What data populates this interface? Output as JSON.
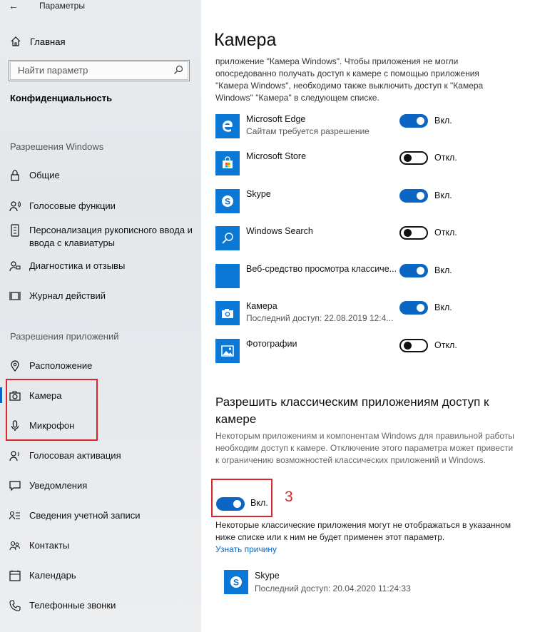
{
  "window": {
    "title": "Параметры"
  },
  "sidebar": {
    "home_label": "Главная",
    "search_placeholder": "Найти параметр",
    "section_title": "Конфиденциальность",
    "group_windows": "Разрешения Windows",
    "group_apps": "Разрешения приложений",
    "items": [
      {
        "label": "Общие",
        "icon": "lock-icon"
      },
      {
        "label": "Голосовые функции",
        "icon": "voice-icon"
      },
      {
        "label": "Персонализация рукописного ввода и ввода с клавиатуры",
        "icon": "handwriting-icon"
      },
      {
        "label": "Диагностика и отзывы",
        "icon": "feedback-icon"
      },
      {
        "label": "Журнал действий",
        "icon": "history-icon"
      },
      {
        "label": "Расположение",
        "icon": "location-icon"
      },
      {
        "label": "Камера",
        "icon": "camera-icon"
      },
      {
        "label": "Микрофон",
        "icon": "microphone-icon"
      },
      {
        "label": "Голосовая активация",
        "icon": "voice-activation-icon"
      },
      {
        "label": "Уведомления",
        "icon": "notifications-icon"
      },
      {
        "label": "Сведения учетной записи",
        "icon": "account-icon"
      },
      {
        "label": "Контакты",
        "icon": "contacts-icon"
      },
      {
        "label": "Календарь",
        "icon": "calendar-icon"
      },
      {
        "label": "Телефонные звонки",
        "icon": "phone-icon"
      }
    ]
  },
  "main": {
    "title": "Камера",
    "intro": "приложение \"Камера Windows\". Чтобы приложения не могли опосредованно получать доступ к камере с помощью приложения \"Камера Windows\", необходимо также выключить доступ к \"Камера Windows\" \"Камера\" в следующем списке.",
    "apps": [
      {
        "name": "Microsoft Edge",
        "sub": "Сайтам требуется разрешение",
        "state": "Вкл.",
        "on": true,
        "icon": "edge-icon"
      },
      {
        "name": "Microsoft Store",
        "sub": "",
        "state": "Откл.",
        "on": false,
        "icon": "store-icon"
      },
      {
        "name": "Skype",
        "sub": "",
        "state": "Вкл.",
        "on": true,
        "icon": "skype-icon"
      },
      {
        "name": "Windows Search",
        "sub": "",
        "state": "Откл.",
        "on": false,
        "icon": "search-app-icon"
      },
      {
        "name": "Веб-средство просмотра классиче...",
        "sub": "",
        "state": "Вкл.",
        "on": true,
        "icon": "web-viewer-icon"
      },
      {
        "name": "Камера",
        "sub": "Последний доступ: 22.08.2019 12:4...",
        "state": "Вкл.",
        "on": true,
        "icon": "camera-app-icon"
      },
      {
        "name": "Фотографии",
        "sub": "",
        "state": "Откл.",
        "on": false,
        "icon": "photos-icon"
      }
    ],
    "classic_heading": "Разрешить классическим приложениям доступ к камере",
    "classic_desc": "Некоторым приложениям и компонентам Windows для правильной работы необходим доступ к камере. Отключение этого параметра может привести к ограничению возможностей классических приложений и Windows.",
    "classic_toggle_label": "Вкл.",
    "annotation_number": "3",
    "note": "Некоторые классические приложения могут не отображаться в указанном ниже списке или к ним не будет применен этот параметр.",
    "learn_more": "Узнать причину",
    "classic_app": {
      "name": "Skype",
      "sub": "Последний доступ: 20.04.2020 11:24:33",
      "icon": "skype-icon"
    }
  },
  "colors": {
    "accent": "#0a66c2",
    "tile": "#0a78d4",
    "annotation": "#d9262a"
  }
}
